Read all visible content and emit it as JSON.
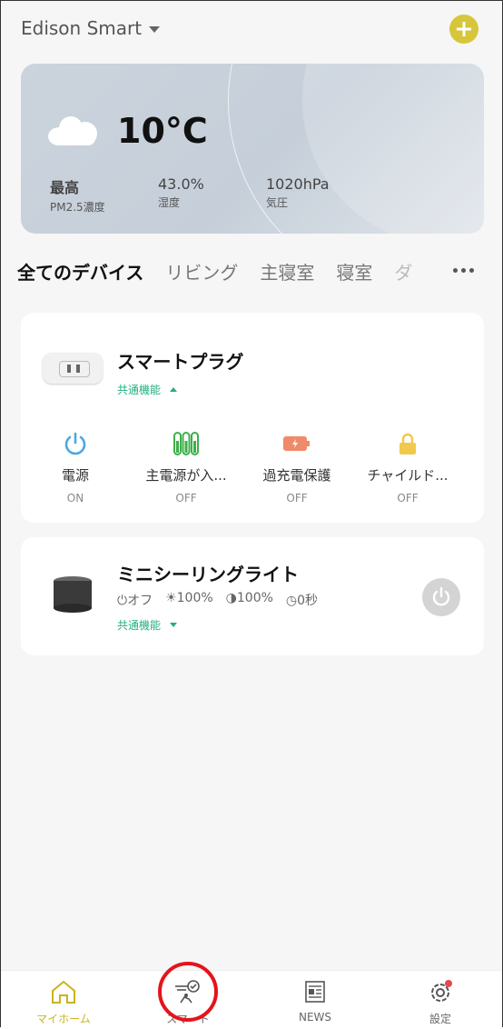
{
  "header": {
    "home_name": "Edison Smart"
  },
  "weather": {
    "temperature": "10°C",
    "stats": [
      {
        "value": "最高",
        "label": "PM2.5濃度"
      },
      {
        "value": "43.0%",
        "label": "湿度"
      },
      {
        "value": "1020hPa",
        "label": "気圧"
      }
    ]
  },
  "tabs": [
    "全てのデバイス",
    "リビング",
    "主寝室",
    "寝室",
    "ダ"
  ],
  "devices": {
    "plug": {
      "name": "スマートプラグ",
      "common": "共通機能",
      "functions": [
        {
          "label": "電源",
          "state": "ON"
        },
        {
          "label": "主電源が入...",
          "state": "OFF"
        },
        {
          "label": "過充電保護",
          "state": "OFF"
        },
        {
          "label": "チャイルド...",
          "state": "OFF"
        }
      ]
    },
    "light": {
      "name": "ミニシーリングライト",
      "meta": [
        "オフ",
        "100%",
        "100%",
        "0秒"
      ],
      "common": "共通機能"
    }
  },
  "bottom_nav": [
    {
      "label": "マイホーム"
    },
    {
      "label": "スマート"
    },
    {
      "label": "NEWS"
    },
    {
      "label": "設定"
    }
  ],
  "colors": {
    "accent": "#c9b320",
    "green": "#22b07d",
    "highlight_circle": "#e4141c"
  }
}
